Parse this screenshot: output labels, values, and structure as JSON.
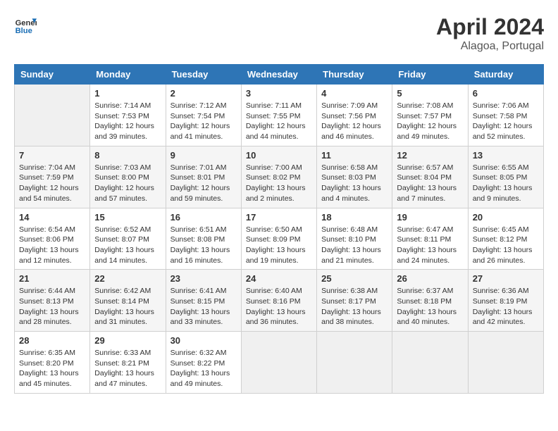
{
  "header": {
    "logo_line1": "General",
    "logo_line2": "Blue",
    "title": "April 2024",
    "location": "Alagoa, Portugal"
  },
  "days_of_week": [
    "Sunday",
    "Monday",
    "Tuesday",
    "Wednesday",
    "Thursday",
    "Friday",
    "Saturday"
  ],
  "weeks": [
    [
      {
        "day": "",
        "sunrise": "",
        "sunset": "",
        "daylight": ""
      },
      {
        "day": "1",
        "sunrise": "Sunrise: 7:14 AM",
        "sunset": "Sunset: 7:53 PM",
        "daylight": "Daylight: 12 hours and 39 minutes."
      },
      {
        "day": "2",
        "sunrise": "Sunrise: 7:12 AM",
        "sunset": "Sunset: 7:54 PM",
        "daylight": "Daylight: 12 hours and 41 minutes."
      },
      {
        "day": "3",
        "sunrise": "Sunrise: 7:11 AM",
        "sunset": "Sunset: 7:55 PM",
        "daylight": "Daylight: 12 hours and 44 minutes."
      },
      {
        "day": "4",
        "sunrise": "Sunrise: 7:09 AM",
        "sunset": "Sunset: 7:56 PM",
        "daylight": "Daylight: 12 hours and 46 minutes."
      },
      {
        "day": "5",
        "sunrise": "Sunrise: 7:08 AM",
        "sunset": "Sunset: 7:57 PM",
        "daylight": "Daylight: 12 hours and 49 minutes."
      },
      {
        "day": "6",
        "sunrise": "Sunrise: 7:06 AM",
        "sunset": "Sunset: 7:58 PM",
        "daylight": "Daylight: 12 hours and 52 minutes."
      }
    ],
    [
      {
        "day": "7",
        "sunrise": "Sunrise: 7:04 AM",
        "sunset": "Sunset: 7:59 PM",
        "daylight": "Daylight: 12 hours and 54 minutes."
      },
      {
        "day": "8",
        "sunrise": "Sunrise: 7:03 AM",
        "sunset": "Sunset: 8:00 PM",
        "daylight": "Daylight: 12 hours and 57 minutes."
      },
      {
        "day": "9",
        "sunrise": "Sunrise: 7:01 AM",
        "sunset": "Sunset: 8:01 PM",
        "daylight": "Daylight: 12 hours and 59 minutes."
      },
      {
        "day": "10",
        "sunrise": "Sunrise: 7:00 AM",
        "sunset": "Sunset: 8:02 PM",
        "daylight": "Daylight: 13 hours and 2 minutes."
      },
      {
        "day": "11",
        "sunrise": "Sunrise: 6:58 AM",
        "sunset": "Sunset: 8:03 PM",
        "daylight": "Daylight: 13 hours and 4 minutes."
      },
      {
        "day": "12",
        "sunrise": "Sunrise: 6:57 AM",
        "sunset": "Sunset: 8:04 PM",
        "daylight": "Daylight: 13 hours and 7 minutes."
      },
      {
        "day": "13",
        "sunrise": "Sunrise: 6:55 AM",
        "sunset": "Sunset: 8:05 PM",
        "daylight": "Daylight: 13 hours and 9 minutes."
      }
    ],
    [
      {
        "day": "14",
        "sunrise": "Sunrise: 6:54 AM",
        "sunset": "Sunset: 8:06 PM",
        "daylight": "Daylight: 13 hours and 12 minutes."
      },
      {
        "day": "15",
        "sunrise": "Sunrise: 6:52 AM",
        "sunset": "Sunset: 8:07 PM",
        "daylight": "Daylight: 13 hours and 14 minutes."
      },
      {
        "day": "16",
        "sunrise": "Sunrise: 6:51 AM",
        "sunset": "Sunset: 8:08 PM",
        "daylight": "Daylight: 13 hours and 16 minutes."
      },
      {
        "day": "17",
        "sunrise": "Sunrise: 6:50 AM",
        "sunset": "Sunset: 8:09 PM",
        "daylight": "Daylight: 13 hours and 19 minutes."
      },
      {
        "day": "18",
        "sunrise": "Sunrise: 6:48 AM",
        "sunset": "Sunset: 8:10 PM",
        "daylight": "Daylight: 13 hours and 21 minutes."
      },
      {
        "day": "19",
        "sunrise": "Sunrise: 6:47 AM",
        "sunset": "Sunset: 8:11 PM",
        "daylight": "Daylight: 13 hours and 24 minutes."
      },
      {
        "day": "20",
        "sunrise": "Sunrise: 6:45 AM",
        "sunset": "Sunset: 8:12 PM",
        "daylight": "Daylight: 13 hours and 26 minutes."
      }
    ],
    [
      {
        "day": "21",
        "sunrise": "Sunrise: 6:44 AM",
        "sunset": "Sunset: 8:13 PM",
        "daylight": "Daylight: 13 hours and 28 minutes."
      },
      {
        "day": "22",
        "sunrise": "Sunrise: 6:42 AM",
        "sunset": "Sunset: 8:14 PM",
        "daylight": "Daylight: 13 hours and 31 minutes."
      },
      {
        "day": "23",
        "sunrise": "Sunrise: 6:41 AM",
        "sunset": "Sunset: 8:15 PM",
        "daylight": "Daylight: 13 hours and 33 minutes."
      },
      {
        "day": "24",
        "sunrise": "Sunrise: 6:40 AM",
        "sunset": "Sunset: 8:16 PM",
        "daylight": "Daylight: 13 hours and 36 minutes."
      },
      {
        "day": "25",
        "sunrise": "Sunrise: 6:38 AM",
        "sunset": "Sunset: 8:17 PM",
        "daylight": "Daylight: 13 hours and 38 minutes."
      },
      {
        "day": "26",
        "sunrise": "Sunrise: 6:37 AM",
        "sunset": "Sunset: 8:18 PM",
        "daylight": "Daylight: 13 hours and 40 minutes."
      },
      {
        "day": "27",
        "sunrise": "Sunrise: 6:36 AM",
        "sunset": "Sunset: 8:19 PM",
        "daylight": "Daylight: 13 hours and 42 minutes."
      }
    ],
    [
      {
        "day": "28",
        "sunrise": "Sunrise: 6:35 AM",
        "sunset": "Sunset: 8:20 PM",
        "daylight": "Daylight: 13 hours and 45 minutes."
      },
      {
        "day": "29",
        "sunrise": "Sunrise: 6:33 AM",
        "sunset": "Sunset: 8:21 PM",
        "daylight": "Daylight: 13 hours and 47 minutes."
      },
      {
        "day": "30",
        "sunrise": "Sunrise: 6:32 AM",
        "sunset": "Sunset: 8:22 PM",
        "daylight": "Daylight: 13 hours and 49 minutes."
      },
      {
        "day": "",
        "sunrise": "",
        "sunset": "",
        "daylight": ""
      },
      {
        "day": "",
        "sunrise": "",
        "sunset": "",
        "daylight": ""
      },
      {
        "day": "",
        "sunrise": "",
        "sunset": "",
        "daylight": ""
      },
      {
        "day": "",
        "sunrise": "",
        "sunset": "",
        "daylight": ""
      }
    ]
  ]
}
